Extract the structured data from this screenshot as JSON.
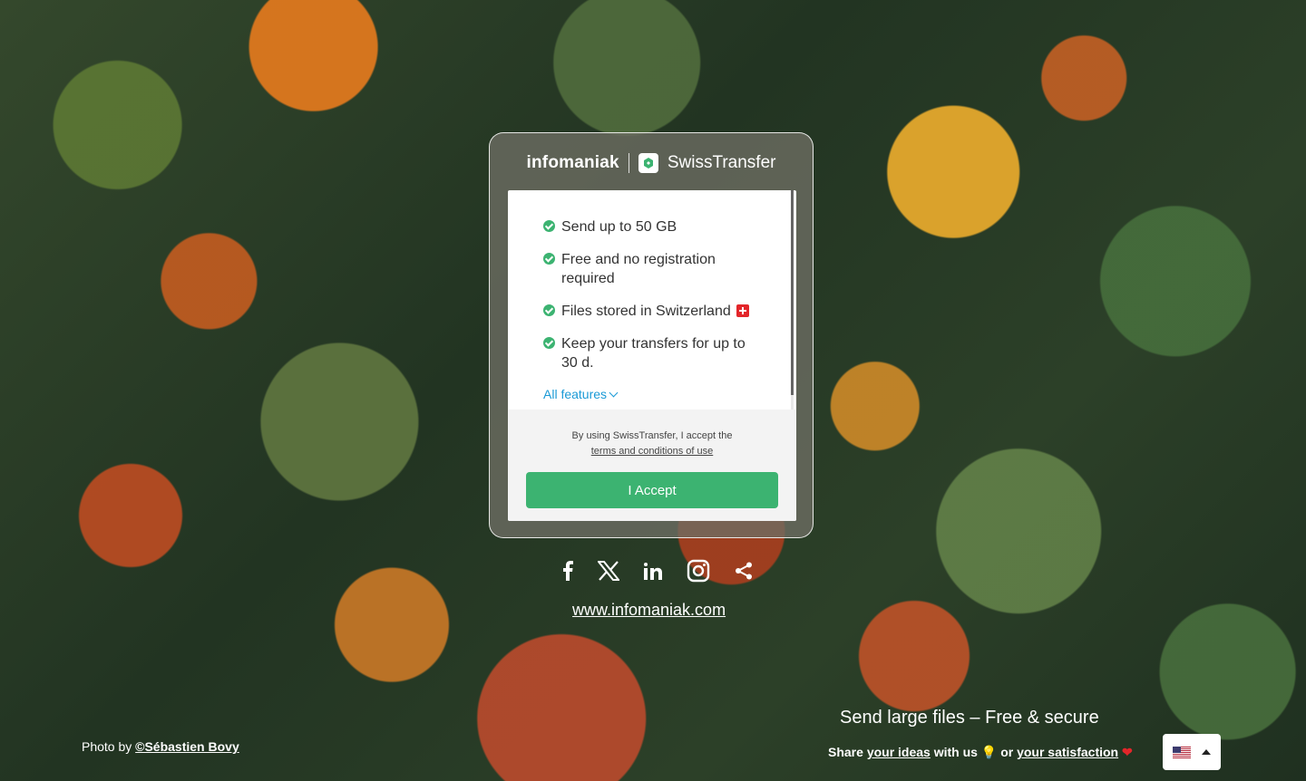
{
  "brand": {
    "company": "infomaniak",
    "product": "SwissTransfer"
  },
  "features": {
    "items": [
      "Send up to 50 GB",
      "Free and no registration required",
      "Files stored in Switzerland",
      "Keep your transfers for up to 30 d."
    ],
    "all_features_label": "All features"
  },
  "terms": {
    "text": "By using SwissTransfer, I accept the",
    "link_label": "terms and conditions of use"
  },
  "accept_button": "I Accept",
  "socials": [
    "facebook-icon",
    "x-icon",
    "linkedin-icon",
    "instagram-icon",
    "share-icon"
  ],
  "site_link": "www.infomaniak.com",
  "photo_credit": {
    "prefix": "Photo by",
    "author": "©Sébastien Bovy"
  },
  "tagline": "Send large files – Free & secure",
  "share": {
    "prefix": "Share",
    "ideas_link": "your ideas",
    "middle": "with us",
    "or": "or",
    "satisfaction_link": "your satisfaction"
  },
  "colors": {
    "accent": "#3cb371",
    "link": "#1a9ad6"
  }
}
